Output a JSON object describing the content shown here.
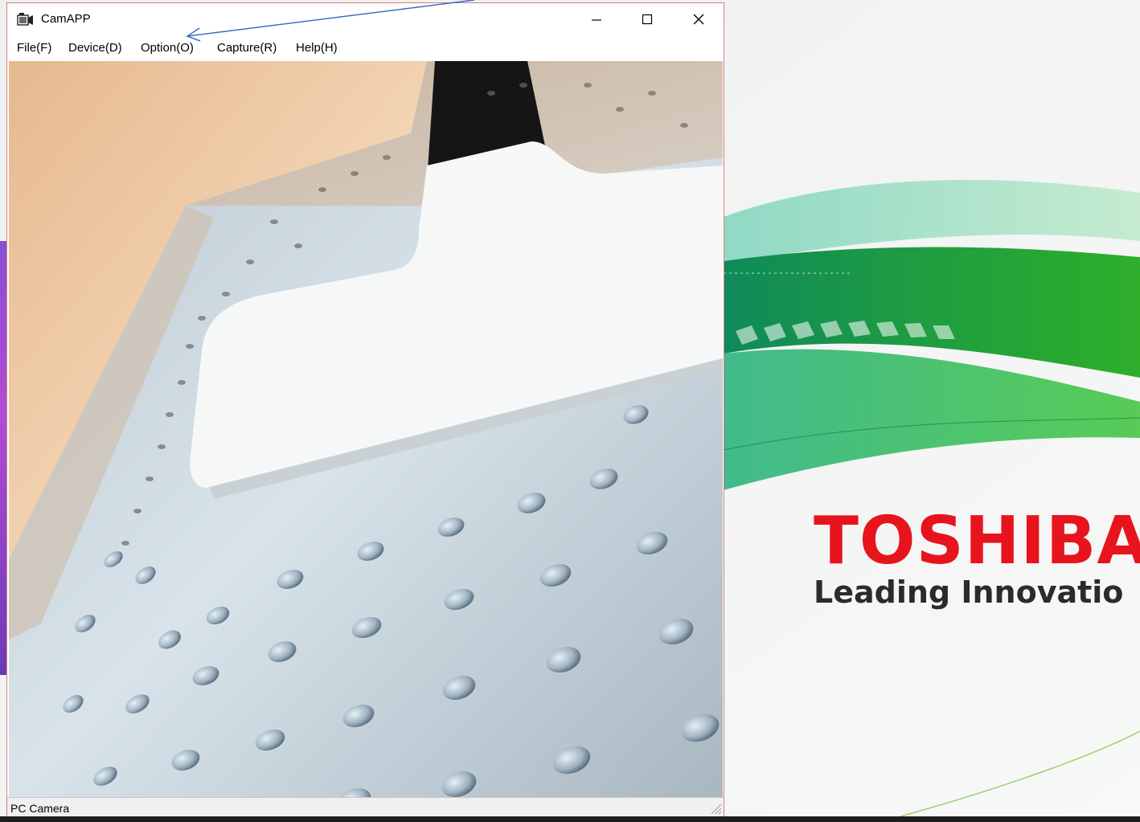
{
  "window": {
    "title": "CamAPP",
    "controls": {
      "minimize": "minimize-icon",
      "maximize": "maximize-icon",
      "close": "close-icon"
    }
  },
  "menu": {
    "file": "File(F)",
    "device": "Device(D)",
    "option": "Option(O)",
    "capture": "Capture(R)",
    "help": "Help(H)"
  },
  "status": {
    "text": "PC Camera"
  },
  "wallpaper": {
    "brand": "TOSHIBA",
    "tagline": "Leading Innovatio",
    "brand_color": "#e8141d",
    "accent_color": "#1a9a3c"
  },
  "annotation": {
    "arrow_color": "#3a6fc4"
  }
}
